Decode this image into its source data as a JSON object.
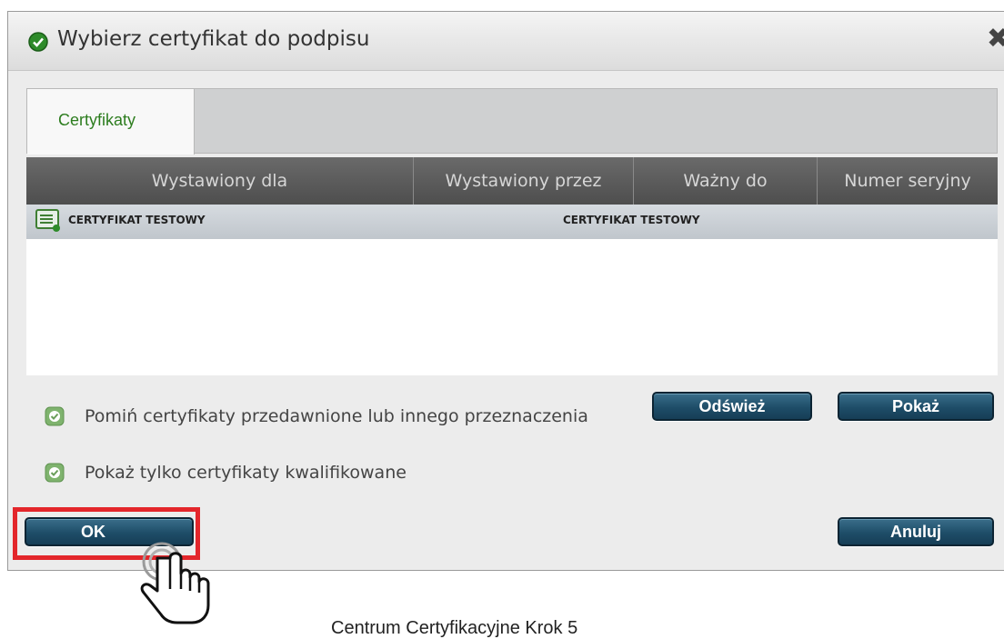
{
  "dialog": {
    "title": "Wybierz certyfikat do podpisu",
    "title_icon": "shield-check-icon",
    "close_glyph": "✖",
    "close_icon": "close-icon"
  },
  "tabs": [
    {
      "label": "Certyfikaty",
      "active": true
    }
  ],
  "table": {
    "columns": [
      "Wystawiony dla",
      "Wystawiony przez",
      "Ważny do",
      "Numer seryjny"
    ],
    "rows": [
      {
        "icon": "certificate-icon",
        "issued_to": "CERTYFIKAT TESTOWY",
        "issued_by": "CERTYFIKAT TESTOWY",
        "valid_to": "",
        "serial": ""
      }
    ]
  },
  "options": {
    "skip_expired": {
      "label": "Pomiń certyfikaty przedawnione lub innego przeznaczenia",
      "checked": true
    },
    "qualified_only": {
      "label": "Pokaż tylko certyfikaty kwalifikowane",
      "checked": true
    }
  },
  "buttons": {
    "refresh": "Odśwież",
    "show": "Pokaż",
    "ok": "OK",
    "cancel": "Anuluj"
  },
  "caption": "Centrum Certyfikacyjne Krok 5",
  "colors": {
    "accent_green": "#2d7d1f",
    "button_blue": "#1e4d68",
    "highlight_red": "#e3262b",
    "header_dark": "#555555"
  },
  "annotation_icons": [
    "pointer-hand-icon"
  ]
}
